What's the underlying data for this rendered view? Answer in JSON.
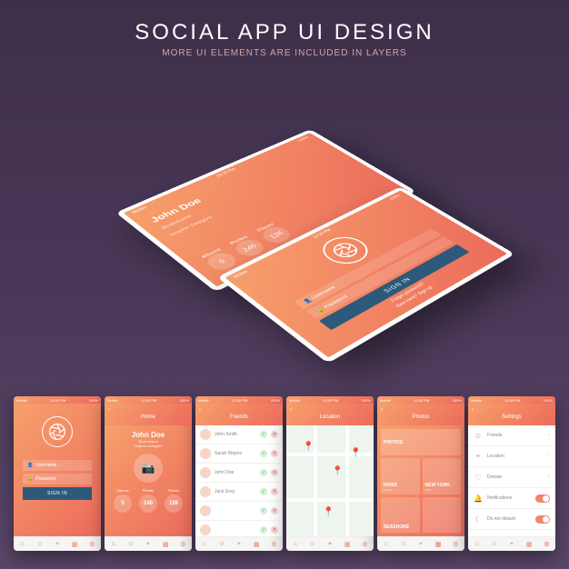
{
  "header": {
    "title": "SOCIAL APP UI DESIGN",
    "subtitle": "MORE UI ELEMENTS ARE INCLUDED IN LAYERS"
  },
  "status": {
    "carrier": "Mobile",
    "time": "12:00 PM",
    "battery": "100%"
  },
  "login": {
    "username_ph": "Username",
    "password_ph": "Password",
    "signin": "SIGN IN",
    "forgot": "Forgot password?",
    "signup": "New Here? Sign up"
  },
  "profile": {
    "name": "John Doe",
    "handle": "@username",
    "role": "Graphic Designer",
    "stats": [
      {
        "label": "Albums",
        "value": "5"
      },
      {
        "label": "Photos",
        "value": "240"
      },
      {
        "label": "Places",
        "value": "126"
      }
    ]
  },
  "screens": {
    "home": "Home",
    "friends": {
      "title": "Friends",
      "items": [
        "John Smith",
        "Sarah Wayne",
        "John Doe",
        "Jack Grey",
        "",
        ""
      ]
    },
    "location": {
      "title": "Location"
    },
    "photos": {
      "title": "Photos",
      "header": "PHOTOS",
      "tiles": [
        {
          "name": "PARIS",
          "sub": "France"
        },
        {
          "name": "NEW YORK",
          "sub": "USA"
        },
        {
          "name": "SEASHORE",
          "sub": ""
        },
        {
          "name": "",
          "sub": ""
        }
      ]
    },
    "settings": {
      "title": "Settings",
      "items": [
        {
          "label": "Friends",
          "type": "link"
        },
        {
          "label": "Location",
          "type": "link"
        },
        {
          "label": "Donate",
          "type": "link"
        },
        {
          "label": "Notifications",
          "type": "toggle",
          "on": true
        },
        {
          "label": "Do not disturb",
          "type": "toggle",
          "on": true
        }
      ]
    }
  }
}
